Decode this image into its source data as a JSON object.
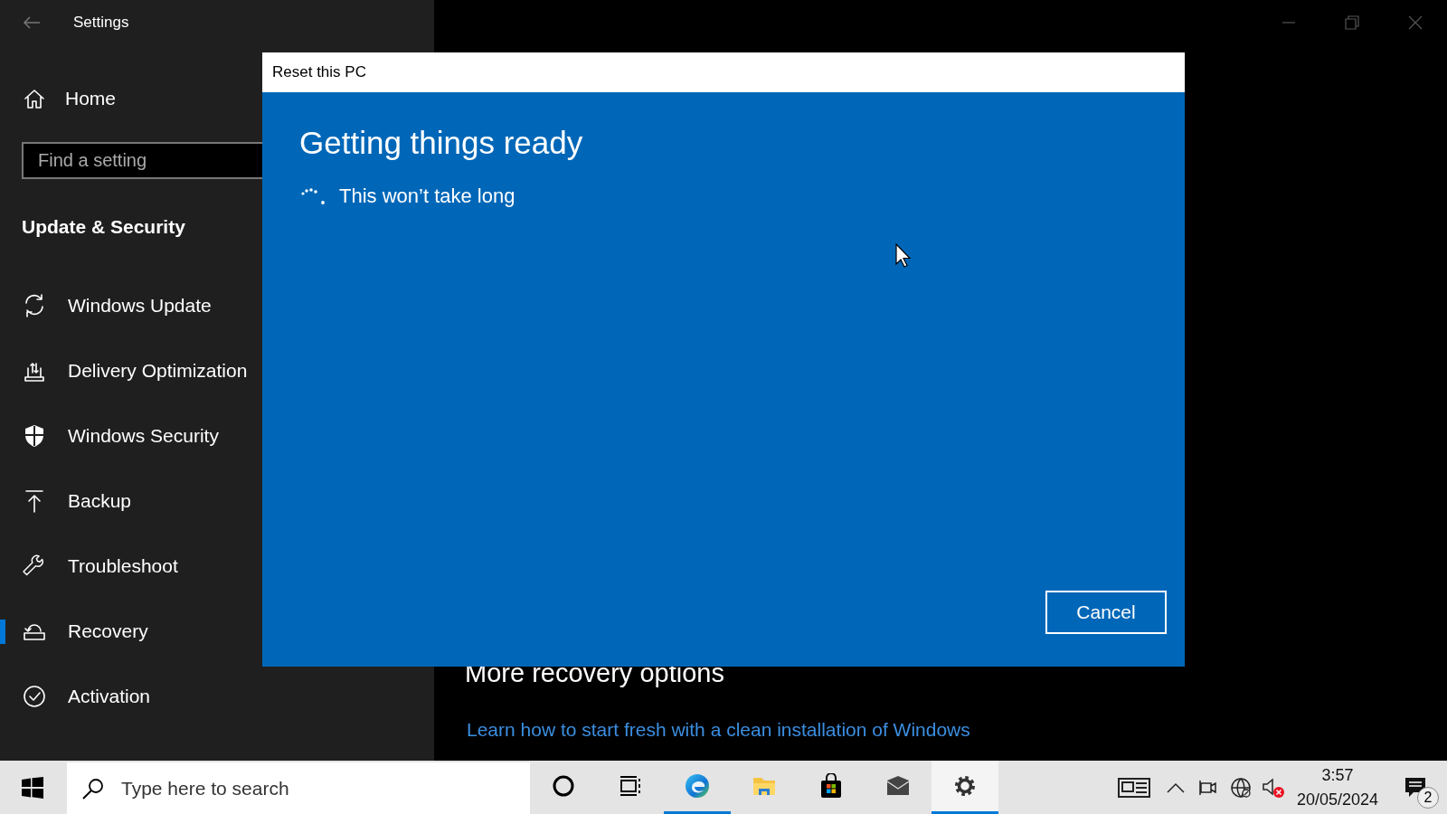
{
  "window": {
    "title": "Settings"
  },
  "sidebar": {
    "home": "Home",
    "search": {
      "placeholder": "Find a setting"
    },
    "section": "Update & Security",
    "items": [
      {
        "label": "Windows Update",
        "selected": false
      },
      {
        "label": "Delivery Optimization",
        "selected": false
      },
      {
        "label": "Windows Security",
        "selected": false
      },
      {
        "label": "Backup",
        "selected": false
      },
      {
        "label": "Troubleshoot",
        "selected": false
      },
      {
        "label": "Recovery",
        "selected": true
      },
      {
        "label": "Activation",
        "selected": false
      }
    ]
  },
  "main": {
    "heading": "More recovery options",
    "link": "Learn how to start fresh with a clean installation of Windows"
  },
  "dialog": {
    "title": "Reset this PC",
    "heading": "Getting things ready",
    "message": "This won’t take long",
    "button": "Cancel"
  },
  "taskbar": {
    "search": {
      "placeholder": "Type here to search"
    },
    "apps": [
      {
        "running": false,
        "active": false
      },
      {
        "running": false,
        "active": false
      },
      {
        "running": true,
        "active": false
      },
      {
        "running": false,
        "active": false
      },
      {
        "running": false,
        "active": false
      },
      {
        "running": false,
        "active": false
      },
      {
        "running": true,
        "active": true
      }
    ],
    "clock": {
      "time": "3:57",
      "date": "20/05/2024"
    },
    "notifications": {
      "count": "2"
    }
  }
}
